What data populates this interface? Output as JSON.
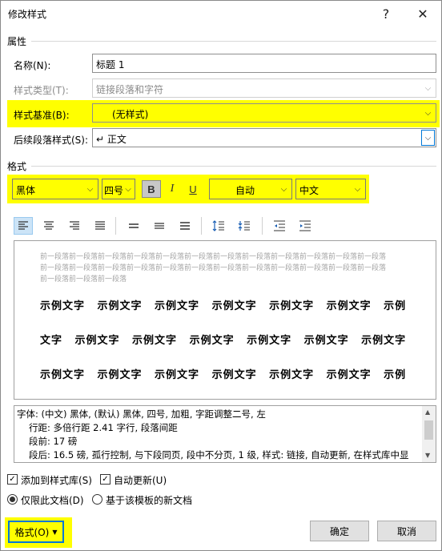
{
  "window": {
    "title": "修改样式",
    "help_icon": "?",
    "close_icon": "✕"
  },
  "properties": {
    "section_label": "属性",
    "name": {
      "label": "名称(N):",
      "value": "标题 1"
    },
    "style_type": {
      "label": "样式类型(T):",
      "value": "链接段落和字符"
    },
    "based_on": {
      "label": "样式基准(B):",
      "value": "(无样式)"
    },
    "next_style": {
      "label": "后续段落样式(S):",
      "value": "↵ 正文"
    }
  },
  "format": {
    "section_label": "格式",
    "font": "黑体",
    "size": "四号",
    "bold": "B",
    "italic": "I",
    "underline": "U",
    "color": "自动",
    "script": "中文"
  },
  "preview": {
    "prev_lines": [
      "前一段落前一段落前一段落前一段落前一段落前一段落前一段落前一段落前一段落前一段落前一段落前一段落",
      "前一段落前一段落前一段落前一段落前一段落前一段落前一段落前一段落前一段落前一段落前一段落前一段落",
      "前一段落前一段落前一段落"
    ],
    "sample_lines": [
      "示例文字 示例文字 示例文字 示例文字 示例文字 示例文字 示例",
      "文字 示例文字 示例文字 示例文字 示例文字 示例文字 示例文字",
      "示例文字 示例文字 示例文字 示例文字 示例文字 示例文字 示例"
    ]
  },
  "description": {
    "lines": [
      "字体: (中文) 黑体, (默认) 黑体, 四号, 加粗, 字距调整二号, 左",
      "行距: 多倍行距 2.41 字行, 段落间距",
      "段前: 17 磅",
      "段后: 16.5 磅, 孤行控制, 与下段同页, 段中不分页, 1 级, 样式: 链接, 自动更新, 在样式库中显"
    ]
  },
  "options": {
    "add_to_gallery": "添加到样式库(S)",
    "auto_update": "自动更新(U)",
    "only_this_doc": "仅限此文档(D)",
    "new_docs_template": "基于该模板的新文档"
  },
  "buttons": {
    "format": "格式(O)",
    "ok": "确定",
    "cancel": "取消"
  },
  "colors": {
    "highlight": "#ffff00",
    "focus": "#0078d7"
  }
}
